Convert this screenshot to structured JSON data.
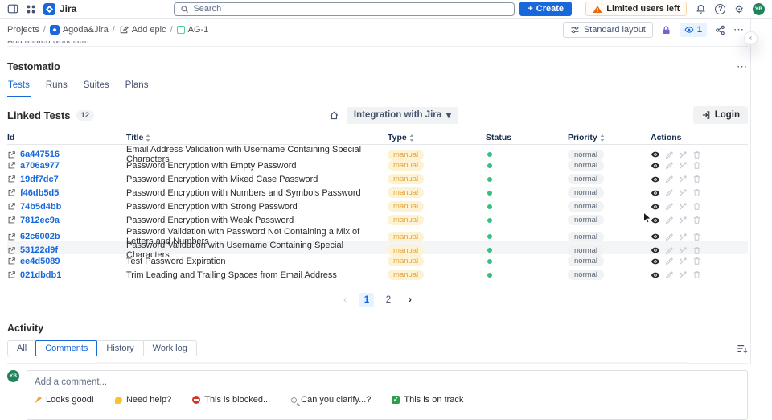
{
  "topbar": {
    "app_name": "Jira",
    "search_placeholder": "Search",
    "create_label": "Create",
    "warning_label": "Limited users left",
    "avatar_initials": "YB"
  },
  "breadcrumb": {
    "projects": "Projects",
    "project": "Agoda&Jira",
    "add_epic": "Add epic",
    "issue": "AG-1",
    "separator": "/"
  },
  "view_controls": {
    "layout_label": "Standard layout",
    "watch_count": "1"
  },
  "hidden_row_label": "Add related work item",
  "testomatio": {
    "title": "Testomatio",
    "tabs": [
      "Tests",
      "Runs",
      "Suites",
      "Plans"
    ],
    "active_tab": "Tests",
    "section_title": "Linked Tests",
    "count": "12",
    "project_selector": "Integration with Jira",
    "login_label": "Login"
  },
  "table": {
    "headers": {
      "id": "Id",
      "title": "Title",
      "type": "Type",
      "status": "Status",
      "priority": "Priority",
      "actions": "Actions"
    },
    "highlighted_id": "53122d9f",
    "status_color": "#36c07e",
    "rows": [
      {
        "id": "6a447516",
        "title": "Email Address Validation with Username Containing Special Characters",
        "type": "manual",
        "status": "green",
        "priority": "normal"
      },
      {
        "id": "a706a977",
        "title": "Password Encryption with Empty Password",
        "type": "manual",
        "status": "green",
        "priority": "normal"
      },
      {
        "id": "19df7dc7",
        "title": "Password Encryption with Mixed Case Password",
        "type": "manual",
        "status": "green",
        "priority": "normal"
      },
      {
        "id": "f46db5d5",
        "title": "Password Encryption with Numbers and Symbols Password",
        "type": "manual",
        "status": "green",
        "priority": "normal"
      },
      {
        "id": "74b5d4bb",
        "title": "Password Encryption with Strong Password",
        "type": "manual",
        "status": "green",
        "priority": "normal"
      },
      {
        "id": "7812ec9a",
        "title": "Password Encryption with Weak Password",
        "type": "manual",
        "status": "green",
        "priority": "normal"
      },
      {
        "id": "62c6002b",
        "title": "Password Validation with Password Not Containing a Mix of Letters and Numbers",
        "type": "manual",
        "status": "green",
        "priority": "normal"
      },
      {
        "id": "53122d9f",
        "title": "Password Validation with Username Containing Special Characters",
        "type": "manual",
        "status": "green",
        "priority": "normal"
      },
      {
        "id": "ee4d5089",
        "title": "Test Password Expiration",
        "type": "manual",
        "status": "green",
        "priority": "normal"
      },
      {
        "id": "021dbdb1",
        "title": "Trim Leading and Trailing Spaces from Email Address",
        "type": "manual",
        "status": "green",
        "priority": "normal"
      }
    ]
  },
  "pagination": {
    "prev": "‹",
    "pages": [
      "1",
      "2"
    ],
    "active": "1",
    "next": "›"
  },
  "activity": {
    "title": "Activity",
    "tabs": [
      "All",
      "Comments",
      "History",
      "Work log"
    ],
    "active_tab": "Comments",
    "avatar_initials": "YB",
    "comment_placeholder": "Add a comment...",
    "quick_replies": [
      {
        "icon": "party-popper",
        "label": "Looks good!"
      },
      {
        "icon": "waving-hand",
        "label": "Need help?"
      },
      {
        "icon": "no-entry",
        "label": "This is blocked..."
      },
      {
        "icon": "magnifier",
        "label": "Can you clarify...?"
      },
      {
        "icon": "check-mark",
        "label": "This is on track"
      }
    ]
  },
  "icons": {
    "more": "⋯",
    "help": "?",
    "gear": "⚙",
    "chevron_down": "▾",
    "collapse": "‹",
    "check": "✓",
    "plus": "+"
  },
  "colors": {
    "brand_blue": "#1868db",
    "warning_orange": "#e56910",
    "lock_purple": "#7a5fd0",
    "status_green": "#36c07e",
    "manual_badge_bg": "#fdf3d3",
    "manual_badge_text": "#e2a340",
    "normal_badge_bg": "#f1f2f4",
    "avatar_green": "#1f845a",
    "watch_badge_bg": "#e9f2ff"
  }
}
